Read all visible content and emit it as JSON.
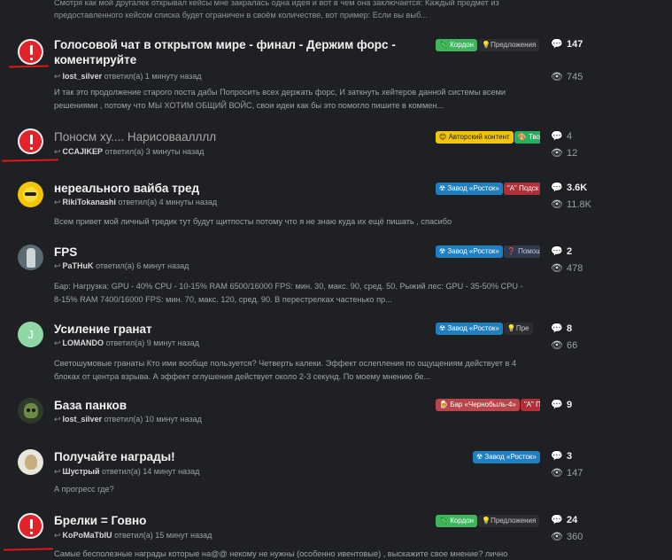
{
  "top_excerpt": {
    "line1": "Смотря как мой другалек открывал кейсы мне закралась одна идея и вот в чем она заключается: Каждый предмет из",
    "line2": "предоставленного кейсом списка будет ограничен в своём количестве, вот пример: Если вы выб..."
  },
  "topics": [
    {
      "title": "Голосовой чат в открытом мире - финал - Держим форс - коментируйте",
      "user": "lost_silver",
      "action": "ответил(а) 1 минуту назад",
      "excerpt": "И так это продолжение старого поста дабы Попросить всех держать форс, И заткнуть хейтеров данной системы всеми решениями , потому что МЫ ХОТИМ ОБЩИЙ ВОЙС, свои идеи как бы это помогло пишите в коммен...",
      "tags": [
        "Кордон",
        "Предложения"
      ],
      "posts": "147",
      "views": "745"
    },
    {
      "title": "Поносм ху.... Нарисоваалллл",
      "user": "CCAJIKEP",
      "action": "ответил(а) 3 минуты назад",
      "excerpt": "",
      "tags": [
        "Авторский контент",
        "Тво"
      ],
      "posts": "4",
      "views": "12"
    },
    {
      "title": "нереального вайба тред",
      "user": "RikiTokanashi",
      "action": "ответил(а) 4 минуты назад",
      "excerpt": "Всем привет мой личный тредик тут будут щитпосты потому что я не знаю куда их ещё пишать , спасибо",
      "tags": [
        "Завод «Росток»",
        "\"A\" Подск"
      ],
      "posts": "3.6K",
      "views": "11.8K"
    },
    {
      "title": "FPS",
      "user": "PaTHuK",
      "action": "ответил(а) 6 минут назад",
      "excerpt": "Бар: Нагрузка: GPU - 40% CPU - 10-15% RAM 6500/16000 FPS: мин. 30, макс. 90, сред. 50. Рыжий лес: GPU - 35-50% CPU - 8-15% RAM 7400/16000 FPS: мин. 70, макс. 120, сред. 90. В перестрелках частенько пр...",
      "tags": [
        "Завод «Росток»",
        "Помощь"
      ],
      "posts": "2",
      "views": "478"
    },
    {
      "title": "Усиление гранат",
      "avatar_letter": "J",
      "user": "LOMANDO",
      "action": "ответил(а) 9 минут назад",
      "excerpt": "Светошумовые гранаты Кто ими вообще пользуется? Четверть калеки. Эффект ослепления по ощущениям действует в 4 блоках от центра взрыва. А эффект оглушения действует около 2-3 секунд. По моему мнению бе...",
      "tags": [
        "Завод «Росток»",
        "Пре"
      ],
      "posts": "8",
      "views": "66"
    },
    {
      "title": "База панков",
      "user": "lost_silver",
      "action": "ответил(а) 10 минут назад",
      "excerpt": "",
      "tags": [
        "Бар «Чернобыль-4»",
        "\"A\" Под"
      ],
      "posts": "9",
      "views": ""
    },
    {
      "title": "Получайте награды!",
      "user": "Шустрый",
      "action": "ответил(а) 14 минут назад",
      "excerpt": "А прогресс где?",
      "tags": [
        "Завод «Росток»"
      ],
      "posts": "3",
      "views": "147"
    },
    {
      "title": "Брелки = Говно",
      "user": "KoPoMaTbIU",
      "action": "ответил(а) 15 минут назад",
      "excerpt": "Самые бесполезные награды которые на@@ некому не нужны (особенно ивентовые) , выскажите свое мнение? лично",
      "tags": [
        "Кордон",
        "Предложения"
      ],
      "posts": "24",
      "views": "360"
    }
  ],
  "colors": {
    "background": "#1f2023",
    "tag_kordon": "#3fb45c",
    "tag_proposals": "#2b2d31",
    "tag_author": "#f1c40f",
    "tag_creative": "#27ae60",
    "tag_rostok": "#1f7fbf",
    "tag_podsk": "#b0303a",
    "tag_help": "#2f3b52",
    "tag_bar": "#b8454b",
    "annotation_red": "#e01818"
  }
}
